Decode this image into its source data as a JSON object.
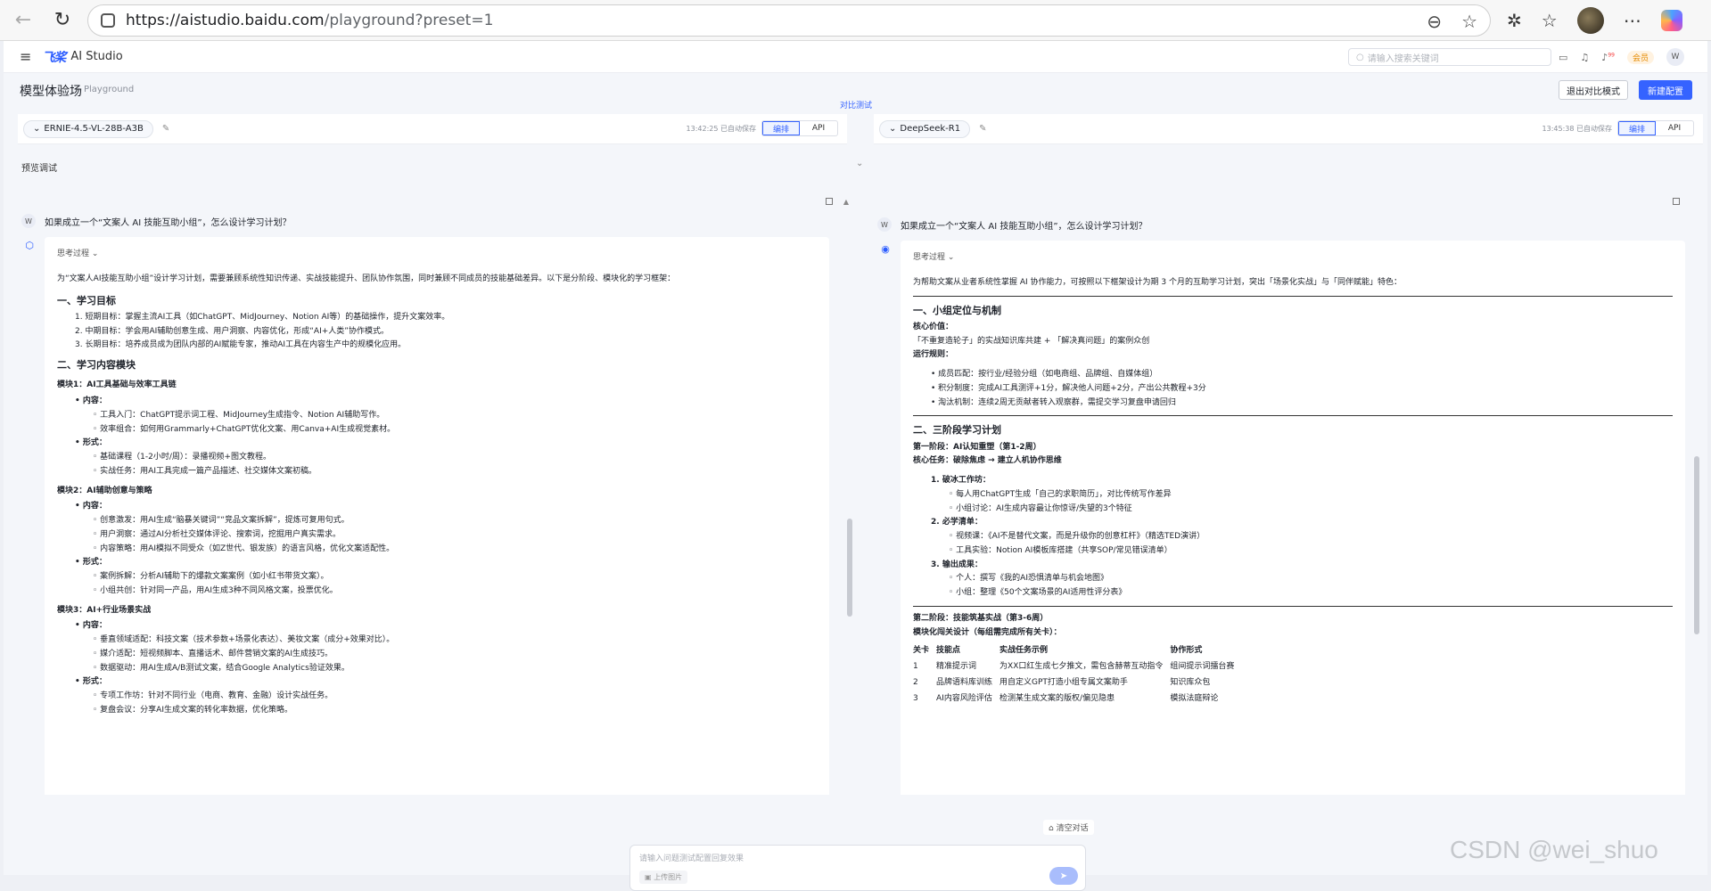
{
  "browser": {
    "url_host": "https://aistudio.baidu.com",
    "url_path": "/playground?preset=1"
  },
  "app": {
    "logo_mark": "飞桨",
    "logo_text": "AI Studio",
    "search_placeholder": "请输入搜索关键词",
    "vip_label": "会员",
    "user_initial": "W",
    "notification_count": "99"
  },
  "header": {
    "title": "模型体验场",
    "subtitle": "Playground",
    "exit_compare": "退出对比模式",
    "new_config": "新建配置",
    "compare_tag": "对比测试"
  },
  "left_model": {
    "name": "ERNIE-4.5-VL-28B-A3B",
    "saved": "13:42:25 已自动保存",
    "tab_edit": "编排",
    "tab_api": "API"
  },
  "right_model": {
    "name": "DeepSeek-R1",
    "saved": "13:45:38 已自动保存",
    "tab_edit": "编排",
    "tab_api": "API"
  },
  "preview": {
    "label": "预览调试"
  },
  "question": "如果成立一个“文案人 AI 技能互助小组”，怎么设计学习计划？",
  "left_answer": {
    "think": "思考过程",
    "intro": "为“文案人AI技能互助小组”设计学习计划，需要兼顾系统性知识传递、实战技能提升、团队协作氛围，同时兼顾不同成员的技能基础差异。以下是分阶段、模块化的学习框架：",
    "s1_title": "一、学习目标",
    "s1_items": [
      "1. 短期目标：掌握主流AI工具（如ChatGPT、MidJourney、Notion AI等）的基础操作，提升文案效率。",
      "2. 中期目标：学会用AI辅助创意生成、用户洞察、内容优化，形成“AI+人类”协作模式。",
      "3. 长期目标：培养成员成为团队内部的AI赋能专家，推动AI工具在内容生产中的规模化应用。"
    ],
    "s2_title": "二、学习内容模块",
    "m1_title": "模块1：AI工具基础与效率工具链",
    "m1_content": "内容：",
    "m1_c1": "工具入门：ChatGPT提示词工程、MidJourney生成指令、Notion AI辅助写作。",
    "m1_c2": "效率组合：如何用Grammarly+ChatGPT优化文案、用Canva+AI生成视觉素材。",
    "m1_form": "形式：",
    "m1_f1": "基础课程（1-2小时/周）：录播视频+图文教程。",
    "m1_f2": "实战任务：用AI工具完成一篇产品描述、社交媒体文案初稿。",
    "m2_title": "模块2：AI辅助创意与策略",
    "m2_content": "内容：",
    "m2_c1": "创意激发：用AI生成“脑暴关键词”“竞品文案拆解”，提炼可复用句式。",
    "m2_c2": "用户洞察：通过AI分析社交媒体评论、搜索词，挖掘用户真实需求。",
    "m2_c3": "内容策略：用AI模拟不同受众（如Z世代、银发族）的语言风格，优化文案适配性。",
    "m2_form": "形式：",
    "m2_f1": "案例拆解：分析AI辅助下的爆款文案案例（如小红书带货文案）。",
    "m2_f2": "小组共创：针对同一产品，用AI生成3种不同风格文案，投票优化。",
    "m3_title": "模块3：AI+行业场景实战",
    "m3_content": "内容：",
    "m3_c1": "垂直领域适配：科技文案（技术参数+场景化表达）、美妆文案（成分+效果对比）。",
    "m3_c2": "媒介适配：短视频脚本、直播话术、邮件营销文案的AI生成技巧。",
    "m3_c3": "数据驱动：用AI生成A/B测试文案，结合Google Analytics验证效果。",
    "m3_form": "形式：",
    "m3_f1": "专项工作坊：针对不同行业（电商、教育、金融）设计实战任务。",
    "m3_f2": "复盘会议：分享AI生成文案的转化率数据，优化策略。"
  },
  "right_answer": {
    "think": "思考过程",
    "intro": "为帮助文案从业者系统性掌握 AI 协作能力，可按照以下框架设计为期 3 个月的互助学习计划，突出「场景化实战」与「同伴赋能」特色：",
    "s1_title": "一、小组定位与机制",
    "core_label": "核心价值：",
    "core_text": "「不重复造轮子」的实战知识库共建 + 「解决真问题」的案例众创",
    "rules_label": "运行规则：",
    "rules": [
      "成员匹配：按行业/经验分组（如电商组、品牌组、自媒体组）",
      "积分制度：完成AI工具测评+1分，解决他人问题+2分，产出公共教程+3分",
      "淘汰机制：连续2周无贡献者转入观察群，需提交学习复盘申请回归"
    ],
    "s2_title": "二、三阶段学习计划",
    "p1_title": "第一阶段：AI认知重塑（第1-2周）",
    "p1_task": "核心任务：破除焦虑 → 建立人机协作思维",
    "p1_i1": "1. 破冰工作坊：",
    "p1_i1a": "每人用ChatGPT生成「自己的求职简历」，对比传统写作差异",
    "p1_i1b": "小组讨论：AI生成内容最让你惊讶/失望的3个特征",
    "p1_i2": "2. 必学清单：",
    "p1_i2a": "视频课：《AI不是替代文案，而是升级你的创意杠杆》（精选TED演讲）",
    "p1_i2b": "工具实验：Notion AI模板库搭建（共享SOP/常见错误清单）",
    "p1_i3": "3. 输出成果：",
    "p1_i3a": "个人：撰写《我的AI恐惧清单与机会地图》",
    "p1_i3b": "小组：整理《50个文案场景的AI适用性评分表》",
    "p2_title": "第二阶段：技能筑基实战（第3-6周）",
    "p2_task": "模块化闯关设计（每组需完成所有关卡）：",
    "table_headers": [
      "关卡",
      "技能点",
      "实战任务示例",
      "协作形式"
    ],
    "table_rows": [
      [
        "1",
        "精准提示词",
        "为XX口红生成七夕推文，需包含赫蒂互动指令",
        "组间提示词擂台赛"
      ],
      [
        "2",
        "品牌语料库训练",
        "用自定义GPT打造小组专属文案助手",
        "知识库众包"
      ],
      [
        "3",
        "AI内容风险评估",
        "检测某生成文案的版权/偏见隐患",
        "模拟法庭辩论"
      ]
    ]
  },
  "bottom": {
    "clear_label": "清空对话",
    "input_placeholder": "请输入问题测试配置回复效果",
    "upload_label": "上传图片"
  },
  "watermark": "CSDN @wei_shuo"
}
